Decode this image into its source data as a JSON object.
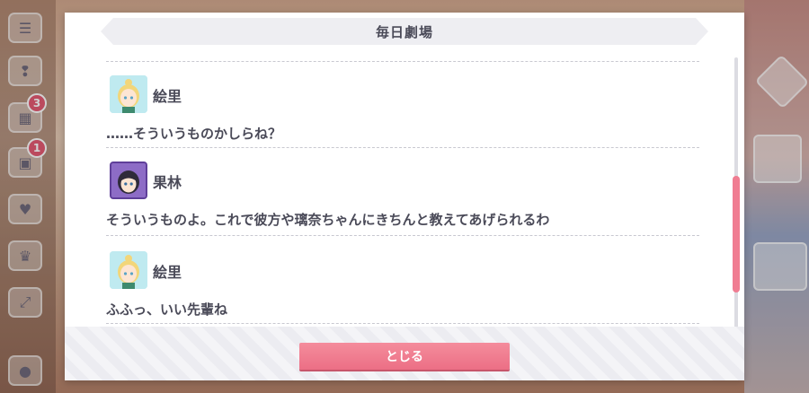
{
  "dialog": {
    "title": "毎日劇場",
    "close_label": "とじる"
  },
  "background": {
    "badges": [
      "3",
      "1"
    ]
  },
  "entries": [
    {
      "speaker": "絵里",
      "text": "……そういうものかしらね？",
      "avatar": "eli-avatar"
    },
    {
      "speaker": "果林",
      "text": "そういうものよ。これで彼方や璃奈ちゃんにきちんと教えてあげられるわ",
      "avatar": "karin-avatar"
    },
    {
      "speaker": "絵里",
      "text": "ふふっ、いい先輩ね",
      "avatar": "eli-avatar"
    }
  ],
  "colors": {
    "accent": "#ec6f85",
    "text": "#4a4a58"
  }
}
